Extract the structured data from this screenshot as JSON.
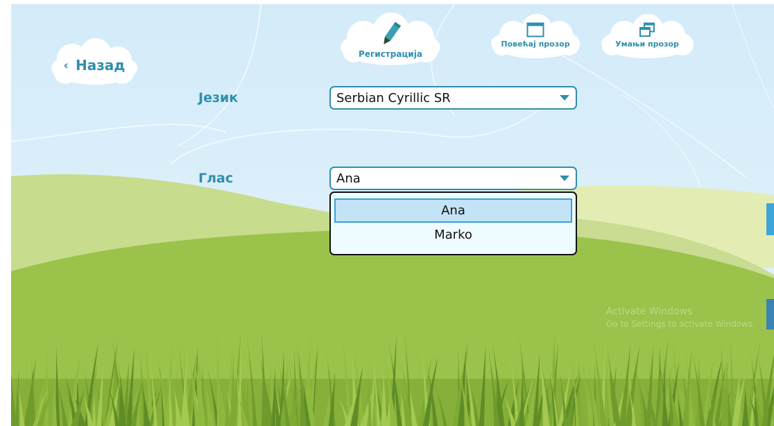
{
  "nav": {
    "back_label": "Назад",
    "back_icon": "chevron-left-icon",
    "register_label": "Регистрација",
    "register_icon": "pencil-icon",
    "maximize_label": "Повећај прозор",
    "maximize_icon": "maximize-window-icon",
    "minimize_label": "Умањи прозор",
    "minimize_icon": "restore-window-icon"
  },
  "settings": {
    "language_label": "Језик",
    "language_value": "Serbian Cyrillic SR",
    "voice_label": "Глас",
    "voice_value": "Ana",
    "voice_options": [
      {
        "label": "Ana",
        "selected": true
      },
      {
        "label": "Marko",
        "selected": false
      }
    ]
  },
  "watermark": {
    "title": "Activate Windows",
    "subtitle": "Go to Settings to activate Windows."
  },
  "colors": {
    "accent": "#2f8fab",
    "sky": "#d6ecf8",
    "grass": "#9bc24a",
    "selection": "#c3e4f6"
  }
}
